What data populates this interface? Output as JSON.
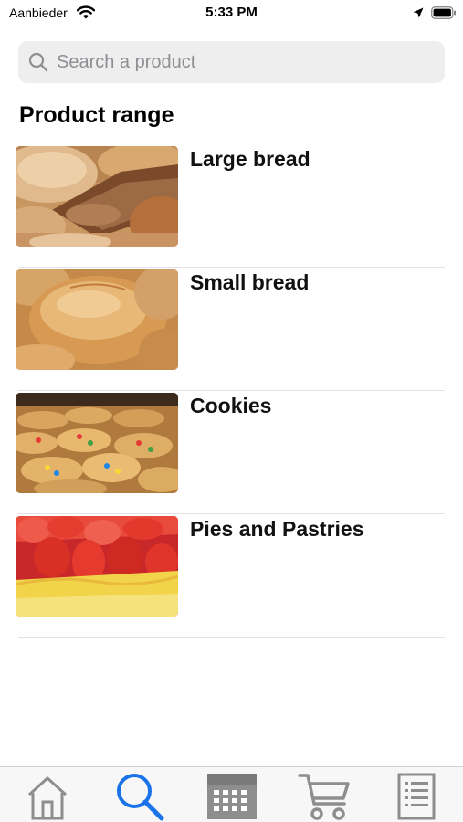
{
  "status_bar": {
    "carrier": "Aanbieder",
    "time": "5:33 PM",
    "icons": [
      "wifi-icon",
      "location-arrow-icon",
      "battery-icon"
    ]
  },
  "search": {
    "placeholder": "Search a product",
    "value": "",
    "icon": "search-icon"
  },
  "section": {
    "title": "Product range"
  },
  "products": [
    {
      "name": "Large bread",
      "image": "large-bread-image"
    },
    {
      "name": "Small bread",
      "image": "small-bread-image"
    },
    {
      "name": "Cookies",
      "image": "cookies-image"
    },
    {
      "name": "Pies and Pastries",
      "image": "pies-pastries-image"
    }
  ],
  "tab_bar": {
    "active": "search",
    "active_color": "#1a73e8",
    "inactive_color": "#8e8e8e",
    "tabs": [
      {
        "id": "home",
        "icon": "home-icon"
      },
      {
        "id": "search",
        "icon": "search-icon"
      },
      {
        "id": "calendar",
        "icon": "calendar-icon"
      },
      {
        "id": "cart",
        "icon": "cart-icon"
      },
      {
        "id": "orders",
        "icon": "list-document-icon"
      }
    ]
  }
}
